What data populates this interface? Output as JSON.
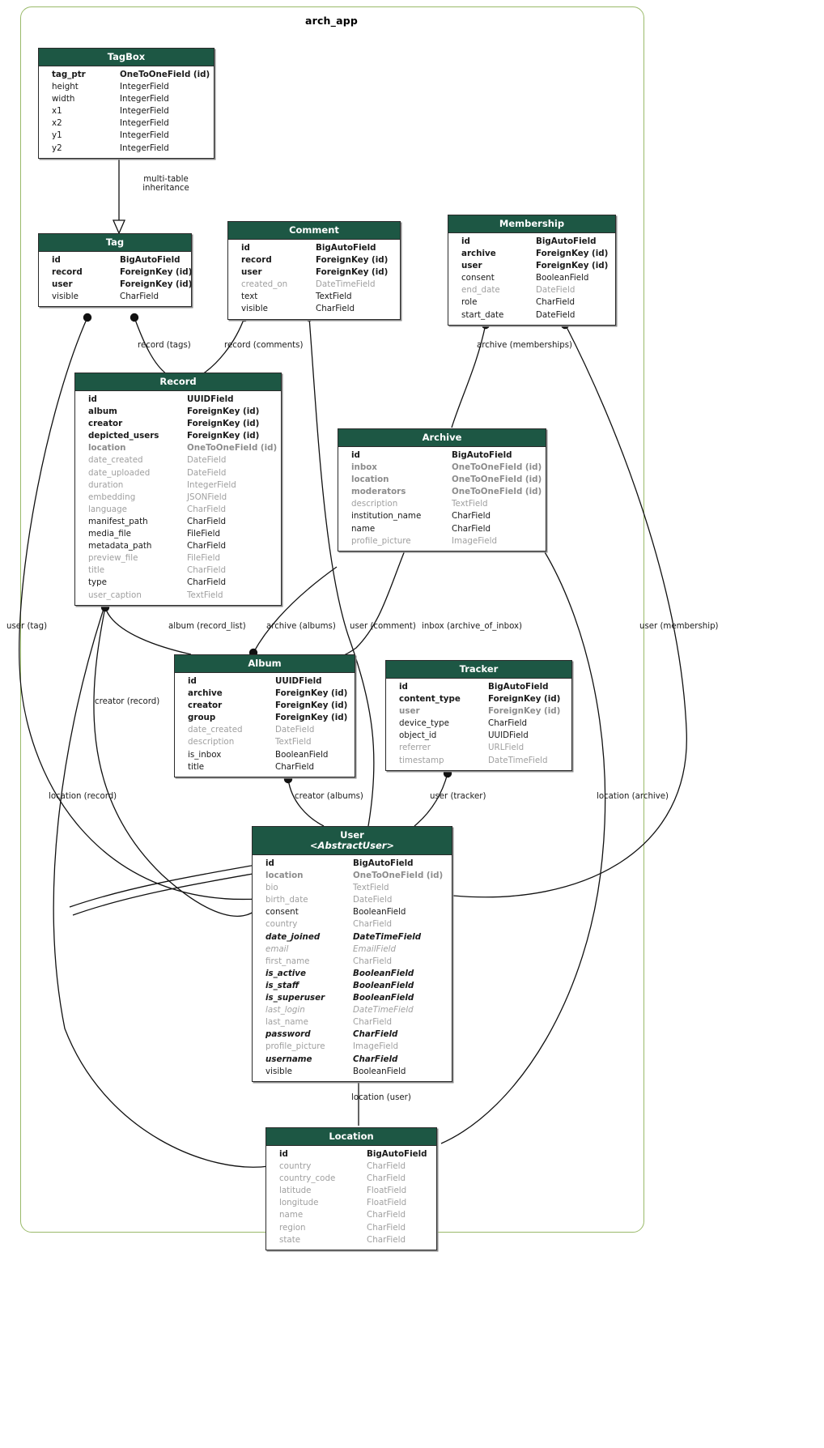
{
  "diagram": {
    "title": "arch_app",
    "frame_color": "#9aba6a",
    "header_color": "#1d5744",
    "header_text_color": "#ffffff",
    "box_border_color": "#2b2b2b"
  },
  "entities": [
    {
      "id": "tagbox",
      "name": "TagBox",
      "stereotype": "",
      "fields": [
        {
          "name": "tag_ptr",
          "type": "OneToOneField (id)",
          "style": "b"
        },
        {
          "name": "height",
          "type": "IntegerField",
          "style": "n"
        },
        {
          "name": "width",
          "type": "IntegerField",
          "style": "n"
        },
        {
          "name": "x1",
          "type": "IntegerField",
          "style": "n"
        },
        {
          "name": "x2",
          "type": "IntegerField",
          "style": "n"
        },
        {
          "name": "y1",
          "type": "IntegerField",
          "style": "n"
        },
        {
          "name": "y2",
          "type": "IntegerField",
          "style": "n"
        }
      ]
    },
    {
      "id": "tag",
      "name": "Tag",
      "stereotype": "",
      "fields": [
        {
          "name": "id",
          "type": "BigAutoField",
          "style": "b"
        },
        {
          "name": "record",
          "type": "ForeignKey (id)",
          "style": "b"
        },
        {
          "name": "user",
          "type": "ForeignKey (id)",
          "style": "b"
        },
        {
          "name": "visible",
          "type": "CharField",
          "style": "n"
        }
      ]
    },
    {
      "id": "comment",
      "name": "Comment",
      "stereotype": "",
      "fields": [
        {
          "name": "id",
          "type": "BigAutoField",
          "style": "b"
        },
        {
          "name": "record",
          "type": "ForeignKey (id)",
          "style": "b"
        },
        {
          "name": "user",
          "type": "ForeignKey (id)",
          "style": "b"
        },
        {
          "name": "created_on",
          "type": "DateTimeField",
          "style": "g"
        },
        {
          "name": "text",
          "type": "TextField",
          "style": "n"
        },
        {
          "name": "visible",
          "type": "CharField",
          "style": "n"
        }
      ]
    },
    {
      "id": "membership",
      "name": "Membership",
      "stereotype": "",
      "fields": [
        {
          "name": "id",
          "type": "BigAutoField",
          "style": "b"
        },
        {
          "name": "archive",
          "type": "ForeignKey (id)",
          "style": "b"
        },
        {
          "name": "user",
          "type": "ForeignKey (id)",
          "style": "b"
        },
        {
          "name": "consent",
          "type": "BooleanField",
          "style": "n"
        },
        {
          "name": "end_date",
          "type": "DateField",
          "style": "g"
        },
        {
          "name": "role",
          "type": "CharField",
          "style": "n"
        },
        {
          "name": "start_date",
          "type": "DateField",
          "style": "n"
        }
      ]
    },
    {
      "id": "record",
      "name": "Record",
      "stereotype": "",
      "fields": [
        {
          "name": "id",
          "type": "UUIDField",
          "style": "b"
        },
        {
          "name": "album",
          "type": "ForeignKey (id)",
          "style": "b"
        },
        {
          "name": "creator",
          "type": "ForeignKey (id)",
          "style": "b"
        },
        {
          "name": "depicted_users",
          "type": "ForeignKey (id)",
          "style": "b"
        },
        {
          "name": "location",
          "type": "OneToOneField (id)",
          "style": "bg"
        },
        {
          "name": "date_created",
          "type": "DateField",
          "style": "g"
        },
        {
          "name": "date_uploaded",
          "type": "DateField",
          "style": "g"
        },
        {
          "name": "duration",
          "type": "IntegerField",
          "style": "g"
        },
        {
          "name": "embedding",
          "type": "JSONField",
          "style": "g"
        },
        {
          "name": "language",
          "type": "CharField",
          "style": "g"
        },
        {
          "name": "manifest_path",
          "type": "CharField",
          "style": "n"
        },
        {
          "name": "media_file",
          "type": "FileField",
          "style": "n"
        },
        {
          "name": "metadata_path",
          "type": "CharField",
          "style": "n"
        },
        {
          "name": "preview_file",
          "type": "FileField",
          "style": "g"
        },
        {
          "name": "title",
          "type": "CharField",
          "style": "g"
        },
        {
          "name": "type",
          "type": "CharField",
          "style": "n"
        },
        {
          "name": "user_caption",
          "type": "TextField",
          "style": "g"
        }
      ]
    },
    {
      "id": "archive",
      "name": "Archive",
      "stereotype": "",
      "fields": [
        {
          "name": "id",
          "type": "BigAutoField",
          "style": "b"
        },
        {
          "name": "inbox",
          "type": "OneToOneField (id)",
          "style": "bg"
        },
        {
          "name": "location",
          "type": "OneToOneField (id)",
          "style": "bg"
        },
        {
          "name": "moderators",
          "type": "OneToOneField (id)",
          "style": "bg"
        },
        {
          "name": "description",
          "type": "TextField",
          "style": "g"
        },
        {
          "name": "institution_name",
          "type": "CharField",
          "style": "n"
        },
        {
          "name": "name",
          "type": "CharField",
          "style": "n"
        },
        {
          "name": "profile_picture",
          "type": "ImageField",
          "style": "g"
        }
      ]
    },
    {
      "id": "album",
      "name": "Album",
      "stereotype": "",
      "fields": [
        {
          "name": "id",
          "type": "UUIDField",
          "style": "b"
        },
        {
          "name": "archive",
          "type": "ForeignKey (id)",
          "style": "b"
        },
        {
          "name": "creator",
          "type": "ForeignKey (id)",
          "style": "b"
        },
        {
          "name": "group",
          "type": "ForeignKey (id)",
          "style": "b"
        },
        {
          "name": "date_created",
          "type": "DateField",
          "style": "g"
        },
        {
          "name": "description",
          "type": "TextField",
          "style": "g"
        },
        {
          "name": "is_inbox",
          "type": "BooleanField",
          "style": "n"
        },
        {
          "name": "title",
          "type": "CharField",
          "style": "n"
        }
      ]
    },
    {
      "id": "tracker",
      "name": "Tracker",
      "stereotype": "",
      "fields": [
        {
          "name": "id",
          "type": "BigAutoField",
          "style": "b"
        },
        {
          "name": "content_type",
          "type": "ForeignKey (id)",
          "style": "b"
        },
        {
          "name": "user",
          "type": "ForeignKey (id)",
          "style": "bg"
        },
        {
          "name": "device_type",
          "type": "CharField",
          "style": "n"
        },
        {
          "name": "object_id",
          "type": "UUIDField",
          "style": "n"
        },
        {
          "name": "referrer",
          "type": "URLField",
          "style": "g"
        },
        {
          "name": "timestamp",
          "type": "DateTimeField",
          "style": "g"
        }
      ]
    },
    {
      "id": "user",
      "name": "User",
      "stereotype": "<AbstractUser>",
      "fields": [
        {
          "name": "id",
          "type": "BigAutoField",
          "style": "b"
        },
        {
          "name": "location",
          "type": "OneToOneField (id)",
          "style": "bg"
        },
        {
          "name": "bio",
          "type": "TextField",
          "style": "g"
        },
        {
          "name": "birth_date",
          "type": "DateField",
          "style": "g"
        },
        {
          "name": "consent",
          "type": "BooleanField",
          "style": "n"
        },
        {
          "name": "country",
          "type": "CharField",
          "style": "g"
        },
        {
          "name": "date_joined",
          "type": "DateTimeField",
          "style": "bi"
        },
        {
          "name": "email",
          "type": "EmailField",
          "style": "gi"
        },
        {
          "name": "first_name",
          "type": "CharField",
          "style": "g"
        },
        {
          "name": "is_active",
          "type": "BooleanField",
          "style": "bi"
        },
        {
          "name": "is_staff",
          "type": "BooleanField",
          "style": "bi"
        },
        {
          "name": "is_superuser",
          "type": "BooleanField",
          "style": "bi"
        },
        {
          "name": "last_login",
          "type": "DateTimeField",
          "style": "gi"
        },
        {
          "name": "last_name",
          "type": "CharField",
          "style": "g"
        },
        {
          "name": "password",
          "type": "CharField",
          "style": "bi"
        },
        {
          "name": "profile_picture",
          "type": "ImageField",
          "style": "g"
        },
        {
          "name": "username",
          "type": "CharField",
          "style": "bi"
        },
        {
          "name": "visible",
          "type": "BooleanField",
          "style": "n"
        }
      ]
    },
    {
      "id": "location",
      "name": "Location",
      "stereotype": "",
      "fields": [
        {
          "name": "id",
          "type": "BigAutoField",
          "style": "b"
        },
        {
          "name": "country",
          "type": "CharField",
          "style": "g"
        },
        {
          "name": "country_code",
          "type": "CharField",
          "style": "g"
        },
        {
          "name": "latitude",
          "type": "FloatField",
          "style": "g"
        },
        {
          "name": "longitude",
          "type": "FloatField",
          "style": "g"
        },
        {
          "name": "name",
          "type": "CharField",
          "style": "g"
        },
        {
          "name": "region",
          "type": "CharField",
          "style": "g"
        },
        {
          "name": "state",
          "type": "CharField",
          "style": "g"
        }
      ]
    }
  ],
  "edge_labels": [
    {
      "id": "inheritance",
      "text": "multi-table\ninheritance"
    },
    {
      "id": "record-tags",
      "text": "record (tags)"
    },
    {
      "id": "record-comments",
      "text": "record (comments)"
    },
    {
      "id": "archive-memberships",
      "text": "archive (memberships)"
    },
    {
      "id": "user-tag",
      "text": "user (tag)"
    },
    {
      "id": "album-record-list",
      "text": "album (record_list)"
    },
    {
      "id": "archive-albums",
      "text": "archive (albums)"
    },
    {
      "id": "user-comment",
      "text": "user (comment)"
    },
    {
      "id": "inbox-archive",
      "text": "inbox (archive_of_inbox)"
    },
    {
      "id": "user-membership",
      "text": "user (membership)"
    },
    {
      "id": "creator-record",
      "text": "creator (record)"
    },
    {
      "id": "location-record",
      "text": "location (record)"
    },
    {
      "id": "creator-albums",
      "text": "creator (albums)"
    },
    {
      "id": "user-tracker",
      "text": "user (tracker)"
    },
    {
      "id": "location-archive",
      "text": "location (archive)"
    },
    {
      "id": "location-user",
      "text": "location (user)"
    }
  ]
}
